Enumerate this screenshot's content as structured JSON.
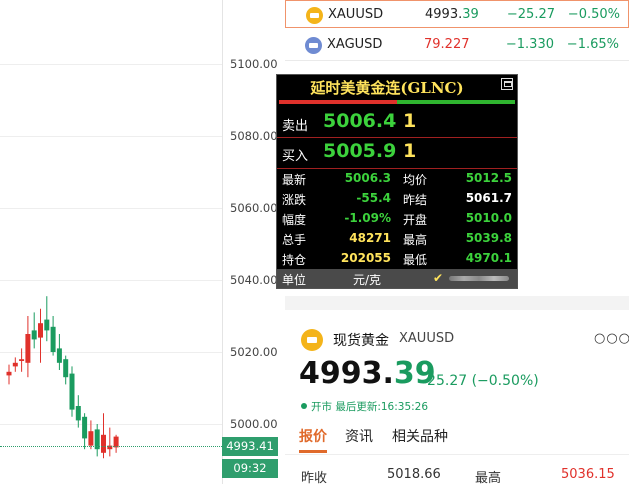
{
  "chart": {
    "y_ticks": [
      "5100.00",
      "5080.00",
      "5060.00",
      "5040.00",
      "5020.00",
      "5000.00"
    ],
    "price_label": "4993.41",
    "time_label": "09:32",
    "up_color": "#e0312b",
    "down_color": "#1a9b5f",
    "candles": [
      {
        "o": 5013.5,
        "h": 5016.5,
        "l": 5011.0,
        "c": 5014.5
      },
      {
        "o": 5016.0,
        "h": 5018.5,
        "l": 5014.5,
        "c": 5017.0
      },
      {
        "o": 5017.5,
        "h": 5021.0,
        "l": 5014.5,
        "c": 5018.0
      },
      {
        "o": 5017.0,
        "h": 5030.0,
        "l": 5013.0,
        "c": 5025.0
      },
      {
        "o": 5026.0,
        "h": 5031.0,
        "l": 5021.0,
        "c": 5023.5
      },
      {
        "o": 5024.0,
        "h": 5032.0,
        "l": 5017.0,
        "c": 5028.0
      },
      {
        "o": 5029.0,
        "h": 5035.5,
        "l": 5023.0,
        "c": 5026.0
      },
      {
        "o": 5027.0,
        "h": 5030.0,
        "l": 5019.0,
        "c": 5020.0
      },
      {
        "o": 5021.0,
        "h": 5025.0,
        "l": 5015.0,
        "c": 5017.0
      },
      {
        "o": 5018.0,
        "h": 5019.0,
        "l": 5011.0,
        "c": 5013.0
      },
      {
        "o": 5014.0,
        "h": 5016.0,
        "l": 5002.0,
        "c": 5004.0
      },
      {
        "o": 5005.0,
        "h": 5008.0,
        "l": 4999.0,
        "c": 5001.0
      },
      {
        "o": 5002.0,
        "h": 5003.0,
        "l": 4993.0,
        "c": 4996.0
      },
      {
        "o": 4994.0,
        "h": 5001.0,
        "l": 4993.0,
        "c": 4998.0
      },
      {
        "o": 4998.5,
        "h": 5000.0,
        "l": 4991.0,
        "c": 4993.0
      },
      {
        "o": 4992.0,
        "h": 5003.0,
        "l": 4990.5,
        "c": 4997.0
      },
      {
        "o": 4993.0,
        "h": 4999.0,
        "l": 4991.0,
        "c": 4994.0
      },
      {
        "o": 4993.5,
        "h": 4997.0,
        "l": 4992.0,
        "c": 4996.5
      }
    ]
  },
  "quotes": [
    {
      "symbol": "XAUUSD",
      "price_int": "4993.",
      "price_dec": "39",
      "change": "−25.27",
      "pct": "−0.50%",
      "icon": "gold-coin-icon"
    },
    {
      "symbol": "XAGUSD",
      "price": "79.227",
      "change": "−1.330",
      "pct": "−1.65%",
      "icon": "silver-coin-icon"
    }
  ],
  "glnc": {
    "title": "延时美黄金连(GLNC)",
    "sell_label": "卖出",
    "sell_price": "5006.4",
    "sell_qty": "1",
    "buy_label": "买入",
    "buy_price": "5005.9",
    "buy_qty": "1",
    "rows": [
      {
        "l1": "最新",
        "v1": "5006.3",
        "l2": "均价",
        "v2": "5012.5"
      },
      {
        "l1": "涨跌",
        "v1": "-55.4",
        "l2": "昨结",
        "v2": "5061.7"
      },
      {
        "l1": "幅度",
        "v1": "-1.09%",
        "l2": "开盘",
        "v2": "5010.0"
      },
      {
        "l1": "总手",
        "v1": "48271",
        "l2": "最高",
        "v2": "5039.8"
      },
      {
        "l1": "持仓",
        "v1": "202055",
        "l2": "最低",
        "v2": "4970.1"
      }
    ],
    "unit_label": "单位",
    "unit_value": "元/克",
    "check": "✔"
  },
  "detail": {
    "name": "现货黄金",
    "symbol": "XAUUSD",
    "more": "○○○",
    "price_int": "4993.",
    "price_dec": "39",
    "change": "-25.27 (−0.50%)",
    "status": "开市",
    "updated": "最后更新:16:35:26",
    "tabs": [
      "报价",
      "资讯",
      "相关品种"
    ],
    "prev_close_label": "昨收",
    "prev_close": "5018.66",
    "high_label": "最高",
    "high": "5036.15"
  }
}
